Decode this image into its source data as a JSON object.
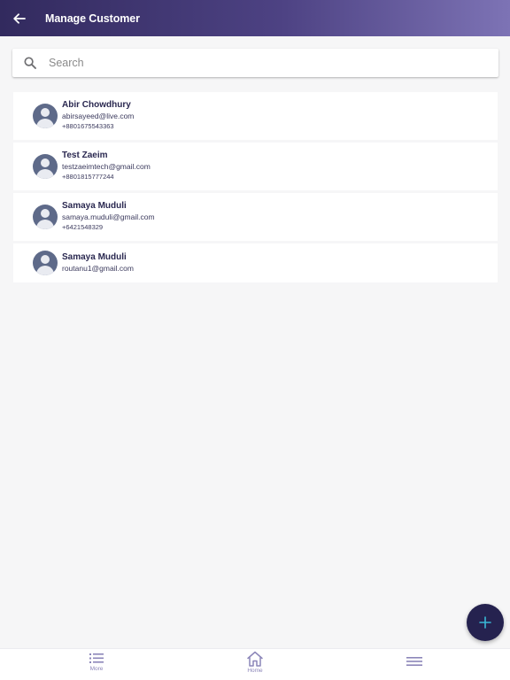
{
  "header": {
    "title": "Manage Customer"
  },
  "search": {
    "placeholder": "Search"
  },
  "customers": [
    {
      "name": "Abir Chowdhury",
      "email": "abirsayeed@live.com",
      "phone": "+8801675543363"
    },
    {
      "name": "Test Zaeim",
      "email": "testzaeimtech@gmail.com",
      "phone": "+8801815777244"
    },
    {
      "name": "Samaya Muduli",
      "email": "samaya.muduli@gmail.com",
      "phone": "+6421548329"
    },
    {
      "name": "Samaya Muduli",
      "email": "routanu1@gmail.com"
    }
  ],
  "bottom_nav": {
    "more_label": "More",
    "home_label": "Home"
  },
  "colors": {
    "header_start": "#322a5e",
    "header_end": "#7d73b5",
    "fab": "#25224f",
    "fab_plus": "#39b8d6",
    "nav_icon": "#8c86b9"
  },
  "icons": {
    "back": "arrow-left-icon",
    "search": "search-icon",
    "avatar": "avatar-icon",
    "fab": "plus-icon",
    "more": "list-icon",
    "home": "home-icon",
    "menu": "hamburger-menu-icon"
  }
}
